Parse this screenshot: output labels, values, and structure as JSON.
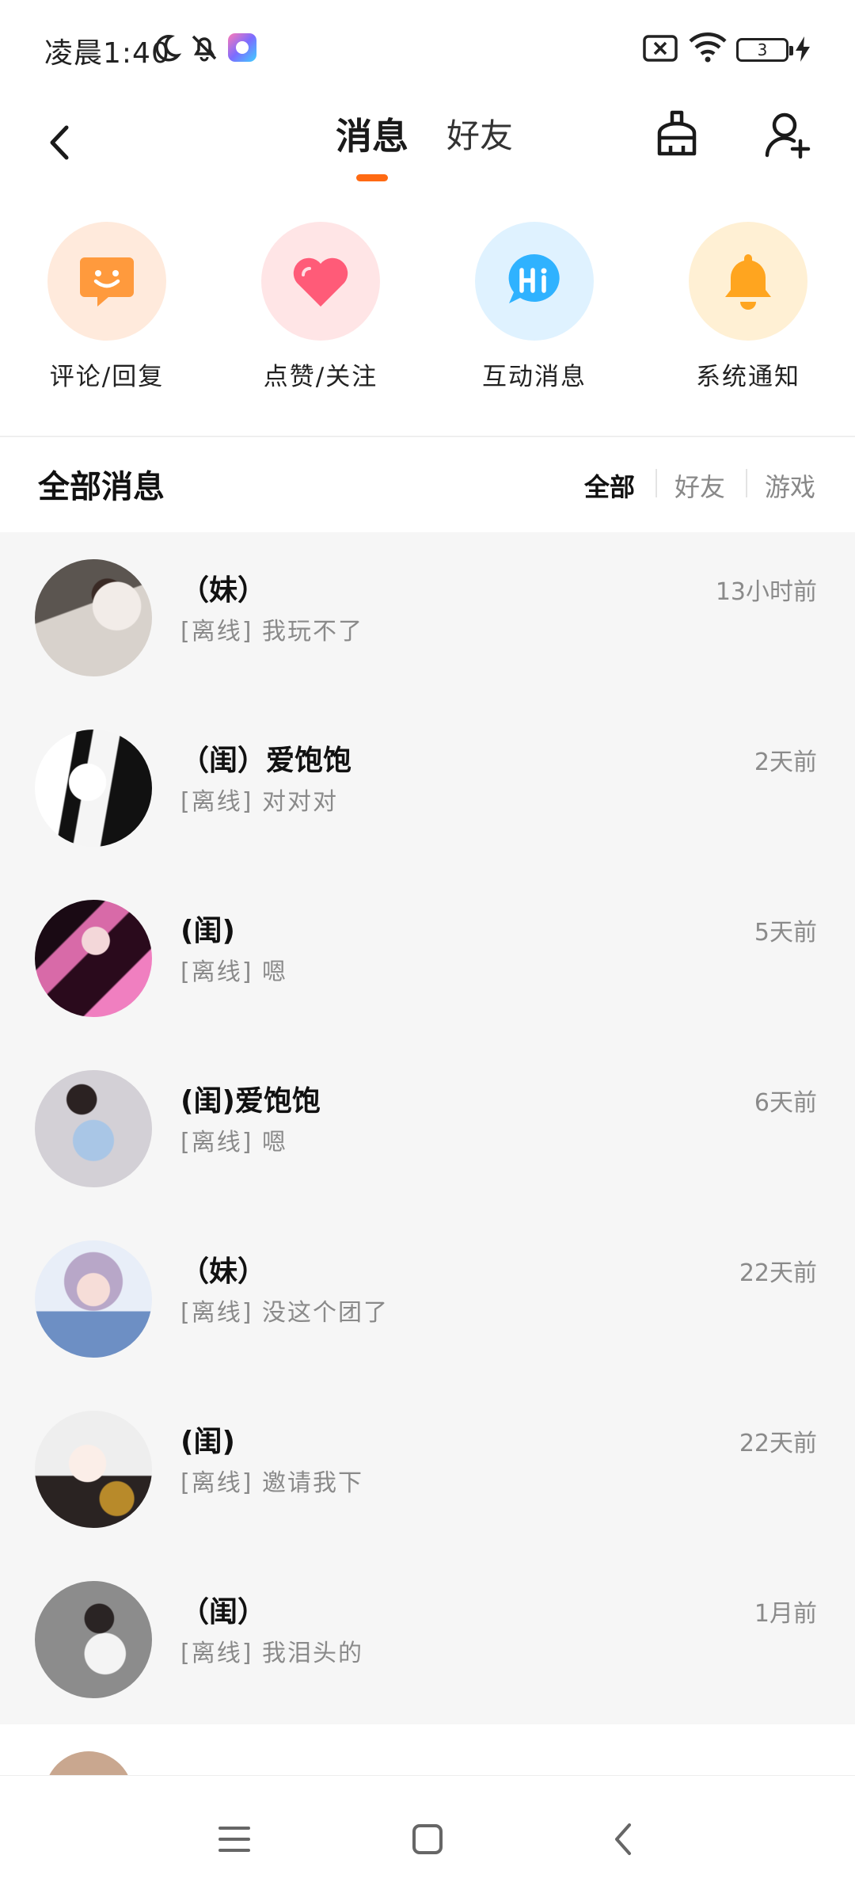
{
  "status_bar": {
    "time": "凌晨1:40",
    "battery": "3"
  },
  "header": {
    "tabs": [
      {
        "label": "消息",
        "active": true
      },
      {
        "label": "好友",
        "active": false
      }
    ],
    "accent_color": "#ff6a13",
    "icons": [
      "back-icon",
      "broom-icon",
      "add-friend-icon"
    ]
  },
  "categories": [
    {
      "label": "评论/回复",
      "icon": "comment-smile-icon",
      "color": "#ff9a3d",
      "bg": "#ffeadc"
    },
    {
      "label": "点赞/关注",
      "icon": "heart-icon",
      "color": "#ff5b78",
      "bg": "#ffe5e6"
    },
    {
      "label": "互动消息",
      "icon": "hi-bubble-icon",
      "color": "#2fb2ff",
      "bg": "#dff2ff"
    },
    {
      "label": "系统通知",
      "icon": "bell-icon",
      "color": "#ffa51f",
      "bg": "#fff0d4"
    }
  ],
  "section": {
    "title": "全部消息",
    "filters": [
      {
        "label": "全部",
        "active": true
      },
      {
        "label": "好友",
        "active": false
      },
      {
        "label": "游戏",
        "active": false
      }
    ]
  },
  "messages": [
    {
      "name": "（妹）",
      "preview": "[离线] 我玩不了",
      "time": "13小时前"
    },
    {
      "name": "（闺）爱饱饱",
      "preview": "[离线] 对对对",
      "time": "2天前"
    },
    {
      "name": "(闺)",
      "preview": "[离线] 嗯",
      "time": "5天前"
    },
    {
      "name": "(闺)爱饱饱",
      "preview": "[离线] 嗯",
      "time": "6天前"
    },
    {
      "name": "（妹）",
      "preview": "[离线] 没这个团了",
      "time": "22天前"
    },
    {
      "name": "(闺)",
      "preview": "[离线] 邀请我下",
      "time": "22天前"
    },
    {
      "name": "（闺）",
      "preview": "[离线] 我泪头的",
      "time": "1月前"
    }
  ],
  "partial_message": {
    "name": "",
    "time": ""
  }
}
